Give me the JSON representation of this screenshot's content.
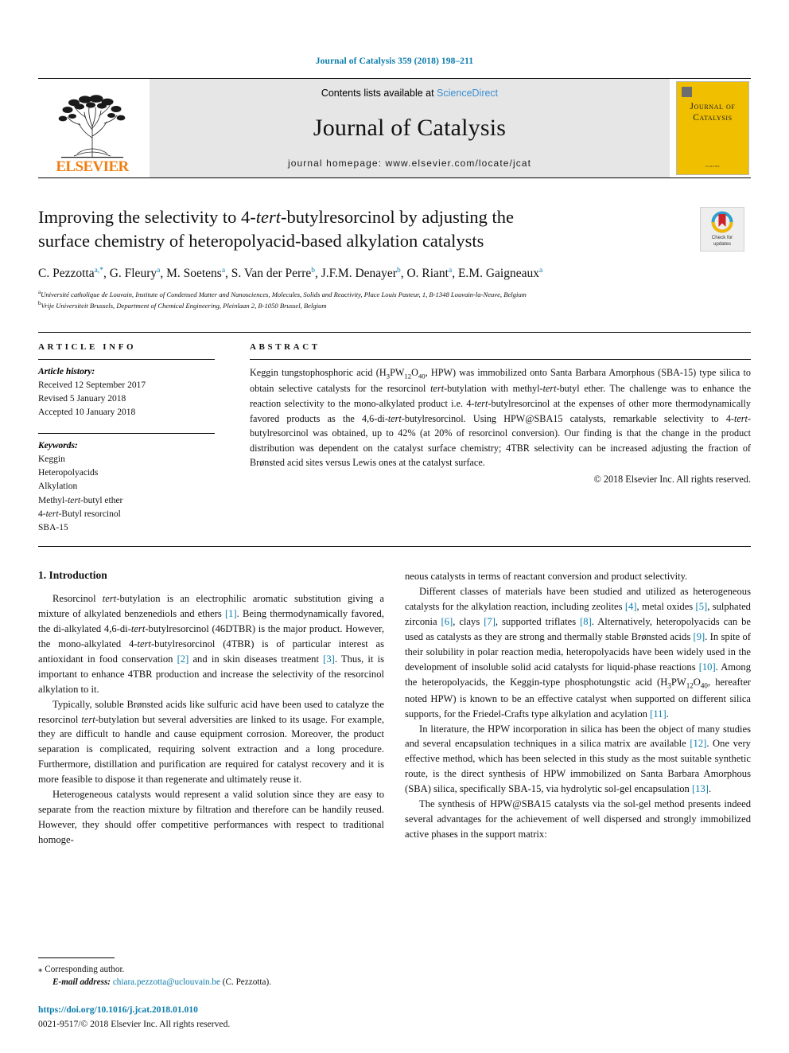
{
  "running_head": "Journal of Catalysis 359 (2018) 198–211",
  "masthead": {
    "publisher_wordmark": "ELSEVIER",
    "contents_prefix": "Contents lists available at ",
    "contents_link": "ScienceDirect",
    "journal_title": "Journal of Catalysis",
    "homepage": "journal homepage: www.elsevier.com/locate/jcat",
    "cover_title_line1": "Journal of",
    "cover_title_line2": "Catalysis",
    "cover_footer": "ELSEVIER"
  },
  "title": {
    "line1_a": "Improving the selectivity to 4-",
    "line1_i": "tert",
    "line1_b": "-butylresorcinol by adjusting the",
    "line2": "surface chemistry of heteropolyacid-based alkylation catalysts",
    "crossmark_label_line1": "Check for",
    "crossmark_label_line2": "updates"
  },
  "authors": [
    {
      "name": "C. Pezzotta",
      "sup": "a,*"
    },
    {
      "name": "G. Fleury",
      "sup": "a"
    },
    {
      "name": "M. Soetens",
      "sup": "a"
    },
    {
      "name": "S. Van der Perre",
      "sup": "b"
    },
    {
      "name": "J.F.M. Denayer",
      "sup": "b"
    },
    {
      "name": "O. Riant",
      "sup": "a"
    },
    {
      "name": "E.M. Gaigneaux",
      "sup": "a"
    }
  ],
  "affiliations": [
    {
      "mark": "a",
      "text": "Université catholique de Louvain, Institute of Condensed Matter and Nanosciences, Molecules, Solids and Reactivity, Place Louis Pasteur, 1, B-1348 Louvain-la-Neuve, Belgium"
    },
    {
      "mark": "b",
      "text": "Vrije Universiteit Brussels, Department of Chemical Engineering, Pleinlaan 2, B-1050 Brussel, Belgium"
    }
  ],
  "article_info": {
    "heading": "ARTICLE INFO",
    "history_label": "Article history:",
    "history": [
      "Received 12 September 2017",
      "Revised 5 January 2018",
      "Accepted 10 January 2018"
    ],
    "keywords_label": "Keywords:",
    "keywords": [
      "Keggin",
      "Heteropolyacids",
      "Alkylation",
      "Methyl-tert-butyl ether",
      "4-tert-Butyl resorcinol",
      "SBA-15"
    ]
  },
  "abstract": {
    "heading": "ABSTRACT",
    "text_part1": "Keggin tungstophosphoric acid (H",
    "formula_sub1": "3",
    "text_part2": "PW",
    "formula_sub2": "12",
    "text_part3": "O",
    "formula_sub3": "40",
    "text_part4": ", HPW) was immobilized onto Santa Barbara Amorphous (SBA-15) type silica to obtain selective catalysts for the resorcinol ",
    "italic1": "tert",
    "text_part5": "-butylation with methyl-",
    "italic2": "tert",
    "text_part6": "-butyl ether. The challenge was to enhance the reaction selectivity to the mono-alkylated product i.e. 4-",
    "italic3": "tert",
    "text_part7": "-butylresorcinol at the expenses of other more thermodynamically favored products as the 4,6-di-",
    "italic4": "tert",
    "text_part8": "-butylresorcinol. Using HPW@SBA15 catalysts, remarkable selectivity to 4-",
    "italic5": "tert",
    "text_part9": "-butylresorcinol was obtained, up to 42% (at 20% of resorcinol conversion). Our finding is that the change in the product distribution was dependent on the catalyst surface chemistry; 4TBR selectivity can be increased adjusting the fraction of Brønsted acid sites versus Lewis ones at the catalyst surface.",
    "copyright": "© 2018 Elsevier Inc. All rights reserved."
  },
  "body": {
    "section_heading": "1. Introduction",
    "left_paragraphs": [
      "Resorcinol tert-butylation is an electrophilic aromatic substitution giving a mixture of alkylated benzenediols and ethers [1]. Being thermodynamically favored, the di-alkylated 4,6-di-tert-butylresorcinol (46DTBR) is the major product. However, the mono-alkylated 4-tert-butylresorcinol (4TBR) is of particular interest as antioxidant in food conservation [2] and in skin diseases treatment [3]. Thus, it is important to enhance 4TBR production and increase the selectivity of the resorcinol alkylation to it.",
      "Typically, soluble Brønsted acids like sulfuric acid have been used to catalyze the resorcinol tert-butylation but several adversities are linked to its usage. For example, they are difficult to handle and cause equipment corrosion. Moreover, the product separation is complicated, requiring solvent extraction and a long procedure. Furthermore, distillation and purification are required for catalyst recovery and it is more feasible to dispose it than regenerate and ultimately reuse it.",
      "Heterogeneous catalysts would represent a valid solution since they are easy to separate from the reaction mixture by filtration and therefore can be handily reused. However, they should offer competitive performances with respect to traditional homoge-"
    ],
    "right_paragraphs": [
      "neous catalysts in terms of reactant conversion and product selectivity.",
      "Different classes of materials have been studied and utilized as heterogeneous catalysts for the alkylation reaction, including zeolites [4], metal oxides [5], sulphated zirconia [6], clays [7], supported triflates [8]. Alternatively, heteropolyacids can be used as catalysts as they are strong and thermally stable Brønsted acids [9]. In spite of their solubility in polar reaction media, heteropolyacids have been widely used in the development of insoluble solid acid catalysts for liquid-phase reactions [10]. Among the heteropolyacids, the Keggin-type phosphotungstic acid (H3PW12O40, hereafter noted HPW) is known to be an effective catalyst when supported on different silica supports, for the Friedel-Crafts type alkylation and acylation [11].",
      "In literature, the HPW incorporation in silica has been the object of many studies and several encapsulation techniques in a silica matrix are available [12]. One very effective method, which has been selected in this study as the most suitable synthetic route, is the direct synthesis of HPW immobilized on Santa Barbara Amorphous (SBA) silica, specifically SBA-15, via hydrolytic sol-gel encapsulation [13].",
      "The synthesis of HPW@SBA15 catalysts via the sol-gel method presents indeed several advantages for the achievement of well dispersed and strongly immobilized active phases in the support matrix:"
    ]
  },
  "footer": {
    "corresponding_star": "⁎",
    "corresponding_text": "Corresponding author.",
    "email_label": "E-mail address:",
    "email": "chiara.pezzotta@uclouvain.be",
    "email_suffix": "(C. Pezzotta).",
    "doi": "https://doi.org/10.1016/j.jcat.2018.01.010",
    "issn": "0021-9517/© 2018 Elsevier Inc. All rights reserved."
  },
  "colors": {
    "link": "#0b7cab",
    "sciencedirect": "#3b8fd4",
    "elsevier_orange": "#f07f13",
    "cover_yellow": "#f0c000",
    "masthead_grey": "#e6e6e6"
  }
}
